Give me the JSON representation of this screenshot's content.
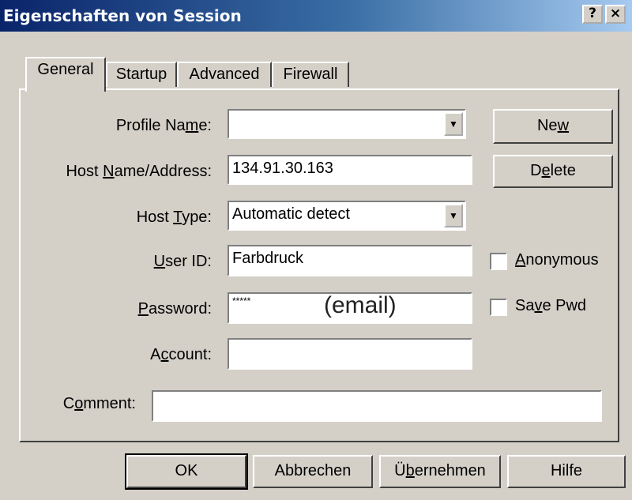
{
  "window": {
    "title": "Eigenschaften von Session",
    "help_button": "?",
    "close_button": "×",
    "colors": {
      "titlebar_start": "#0a246a",
      "titlebar_end": "#a6caf0",
      "face": "#d4d0c8"
    }
  },
  "tabs": [
    {
      "label": "General",
      "active": true
    },
    {
      "label": "Startup",
      "active": false
    },
    {
      "label": "Advanced",
      "active": false
    },
    {
      "label": "Firewall",
      "active": false
    }
  ],
  "form": {
    "profile_name": {
      "label_pre": "Profile Na",
      "label_u": "m",
      "label_post": "e:",
      "value": ""
    },
    "host_name": {
      "label_pre": "Host ",
      "label_u": "N",
      "label_post": "ame/Address:",
      "value": "134.91.30.163"
    },
    "host_type": {
      "label_pre": "Host ",
      "label_u": "T",
      "label_post": "ype:",
      "value": "Automatic detect"
    },
    "user_id": {
      "label_pre": "",
      "label_u": "U",
      "label_post": "ser ID:",
      "value": "Farbdruck"
    },
    "password": {
      "label_pre": "",
      "label_u": "P",
      "label_post": "assword:",
      "value": "*****",
      "annotation": "(email)"
    },
    "account": {
      "label_pre": "A",
      "label_u": "c",
      "label_post": "count:",
      "value": ""
    },
    "comment": {
      "label_pre": "C",
      "label_u": "o",
      "label_post": "mment:",
      "value": ""
    }
  },
  "side_buttons": {
    "new": {
      "pre": "Ne",
      "u": "w",
      "post": ""
    },
    "delete": {
      "pre": "D",
      "u": "e",
      "post": "lete"
    }
  },
  "checkboxes": {
    "anonymous": {
      "pre": "",
      "u": "A",
      "post": "nonymous",
      "checked": false
    },
    "save_pwd": {
      "pre": "Sa",
      "u": "v",
      "post": "e Pwd",
      "checked": false
    }
  },
  "footer_buttons": {
    "ok": "OK",
    "cancel": "Abbrechen",
    "apply": {
      "pre": "Ü",
      "u": "b",
      "post": "ernehmen"
    },
    "help": "Hilfe"
  },
  "icons": {
    "dropdown": "triangle-down-icon"
  }
}
